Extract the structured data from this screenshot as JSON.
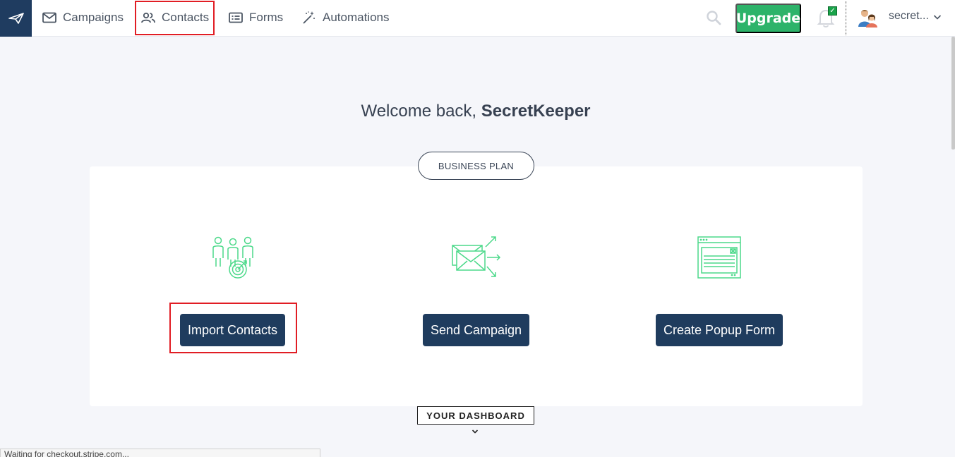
{
  "nav": {
    "items": [
      {
        "label": "Campaigns",
        "icon": "mail-icon"
      },
      {
        "label": "Contacts",
        "icon": "users-icon"
      },
      {
        "label": "Forms",
        "icon": "form-icon"
      },
      {
        "label": "Automations",
        "icon": "magic-wand-icon"
      }
    ],
    "upgrade_label": "Upgrade",
    "user_name": "secret..."
  },
  "main": {
    "welcome_prefix": "Welcome back, ",
    "welcome_name": "SecretKeeper",
    "plan_label": "BUSINESS PLAN",
    "actions": [
      {
        "label": "Import Contacts",
        "icon": "contacts-target-icon"
      },
      {
        "label": "Send Campaign",
        "icon": "send-mail-icon"
      },
      {
        "label": "Create Popup Form",
        "icon": "popup-form-icon"
      }
    ],
    "dashboard_label": "YOUR DASHBOARD"
  },
  "status": {
    "text": "Waiting for checkout.stripe.com..."
  },
  "colors": {
    "brand": "#1f3c60",
    "upgrade": "#2db36a",
    "button": "#1f3c5e",
    "highlight": "#e11d24",
    "icon_green": "#4cd98a"
  }
}
